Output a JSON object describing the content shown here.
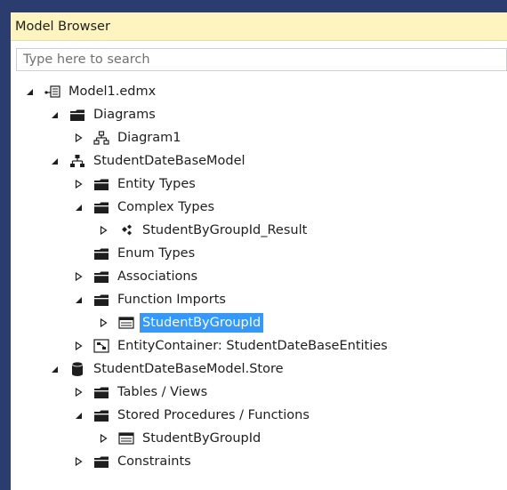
{
  "panel": {
    "title": "Model Browser",
    "search_placeholder": "Type here to search"
  },
  "tree": {
    "model": "Model1.edmx",
    "diagrams": "Diagrams",
    "diagram1": "Diagram1",
    "conceptual_model": "StudentDateBaseModel",
    "entity_types": "Entity Types",
    "complex_types": "Complex Types",
    "complex_result": "StudentByGroupId_Result",
    "enum_types": "Enum Types",
    "associations": "Associations",
    "function_imports": "Function Imports",
    "function_import_item": "StudentByGroupId",
    "entity_container": "EntityContainer: StudentDateBaseEntities",
    "store": "StudentDateBaseModel.Store",
    "tables_views": "Tables / Views",
    "stored_procedures": "Stored Procedures / Functions",
    "stored_procedure_item": "StudentByGroupId",
    "constraints": "Constraints"
  },
  "colors": {
    "titlebar": "#fdf4bf",
    "selection": "#3399ff",
    "frame": "#2b3c6f"
  }
}
